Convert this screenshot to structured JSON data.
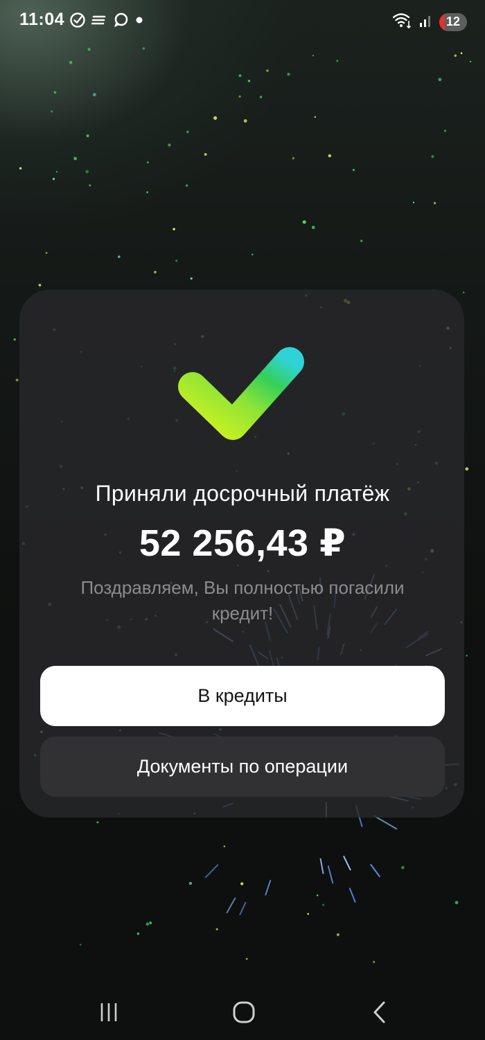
{
  "status_bar": {
    "time": "11:04",
    "battery": "12",
    "icons_left": [
      "check-circle-icon",
      "stack-icon",
      "chat-bubble-icon",
      "dot-icon"
    ],
    "icons_right": [
      "wifi-icon",
      "signal-icon",
      "battery-icon"
    ]
  },
  "result": {
    "title": "Приняли досрочный платёж",
    "amount": "52 256,43 ₽",
    "message": "Поздравляем, Вы полностью погасили кредит!",
    "accent_colors": [
      "#c8f02a",
      "#3ad24a",
      "#2fd3d7"
    ]
  },
  "actions": {
    "primary_label": "В кредиты",
    "secondary_label": "Документы по операции"
  },
  "nav_bar": {
    "icons": [
      "recent-apps-icon",
      "home-icon",
      "back-icon"
    ]
  }
}
